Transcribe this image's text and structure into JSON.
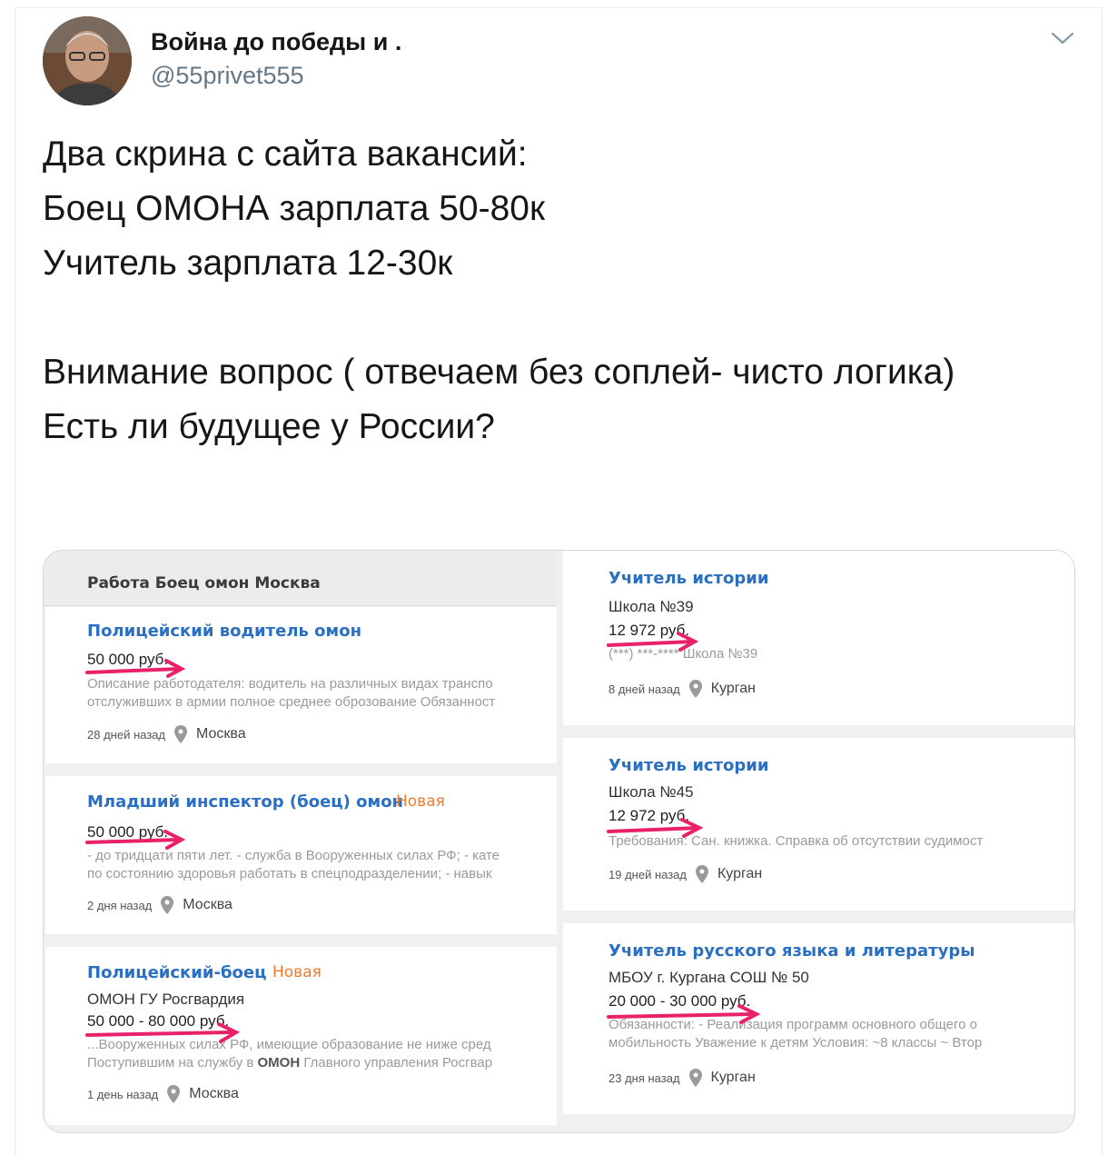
{
  "tweet": {
    "display_name": "Война до победы и .",
    "handle": "@55privet555",
    "text": "Два скрина с сайта вакансий:\nБоец ОМОНА зарплата 50-80к\nУчитель зарплата 12-30к\n\nВнимание вопрос ( отвечаем без соплей- чисто логика)\nЕсть ли будущее у России?"
  },
  "left_panel": {
    "search_title": "Работа Боец омон Москва",
    "jobs": [
      {
        "title": "Полицейский водитель омон",
        "badge": "",
        "employer": "",
        "salary": "50 000 руб.",
        "desc_1": "Описание работодателя: водитель на различных видах транспо",
        "desc_2": "отслуживших в армии полное среднее оброзование Обязанност",
        "date": "28 дней назад",
        "city": "Москва"
      },
      {
        "title": "Младший инспектор (боец) омон",
        "badge": "Новая",
        "employer": "",
        "salary": "50 000 руб.",
        "desc_1": "- до тридцати пяти лет. - служба в Вооруженных силах РФ; - кате",
        "desc_2": "по состоянию здоровья работать в спецподразделении; - навык",
        "date": "2 дня назад",
        "city": "Москва"
      },
      {
        "title": "Полицейский-боец",
        "badge": "Новая",
        "employer": "ОМОН ГУ Росгвардия",
        "salary": "50 000 - 80 000 руб.",
        "desc_1": "...Вооруженных силах РФ, имеющие образование не ниже сред",
        "desc_2_pre": "Поступившим на службу в ",
        "desc_2_bold": "ОМОН",
        "desc_2_post": " Главного управления Росгвар",
        "date": "1 день назад",
        "city": "Москва"
      }
    ]
  },
  "right_panel": {
    "jobs": [
      {
        "title": "Учитель истории",
        "employer": "Школа №39",
        "salary": "12 972 руб.",
        "desc_1": "(***) ***-**** Школа №39",
        "date": "8 дней назад",
        "city": "Курган"
      },
      {
        "title": "Учитель истории",
        "employer": "Школа №45",
        "salary": "12 972 руб.",
        "desc_1": "Требования: Сан. книжка. Справка об отсутствии судимост",
        "date": "19 дней назад",
        "city": "Курган"
      },
      {
        "title": "Учитель русского языка и литературы",
        "employer": "МБОУ г. Кургана СОШ № 50",
        "salary": "20 000 - 30 000 руб.",
        "desc_1": "Обязанности: - Реализация программ основного общего о",
        "desc_2": "мобильность Уважение к детям Условия: ~8 классы ~ Втор",
        "date": "23 дня назад",
        "city": "Курган"
      }
    ]
  },
  "colors": {
    "job_title": "#2b6fc2",
    "badge_new": "#f07b2a",
    "arrow": "#e8216a",
    "handle": "#657786"
  }
}
